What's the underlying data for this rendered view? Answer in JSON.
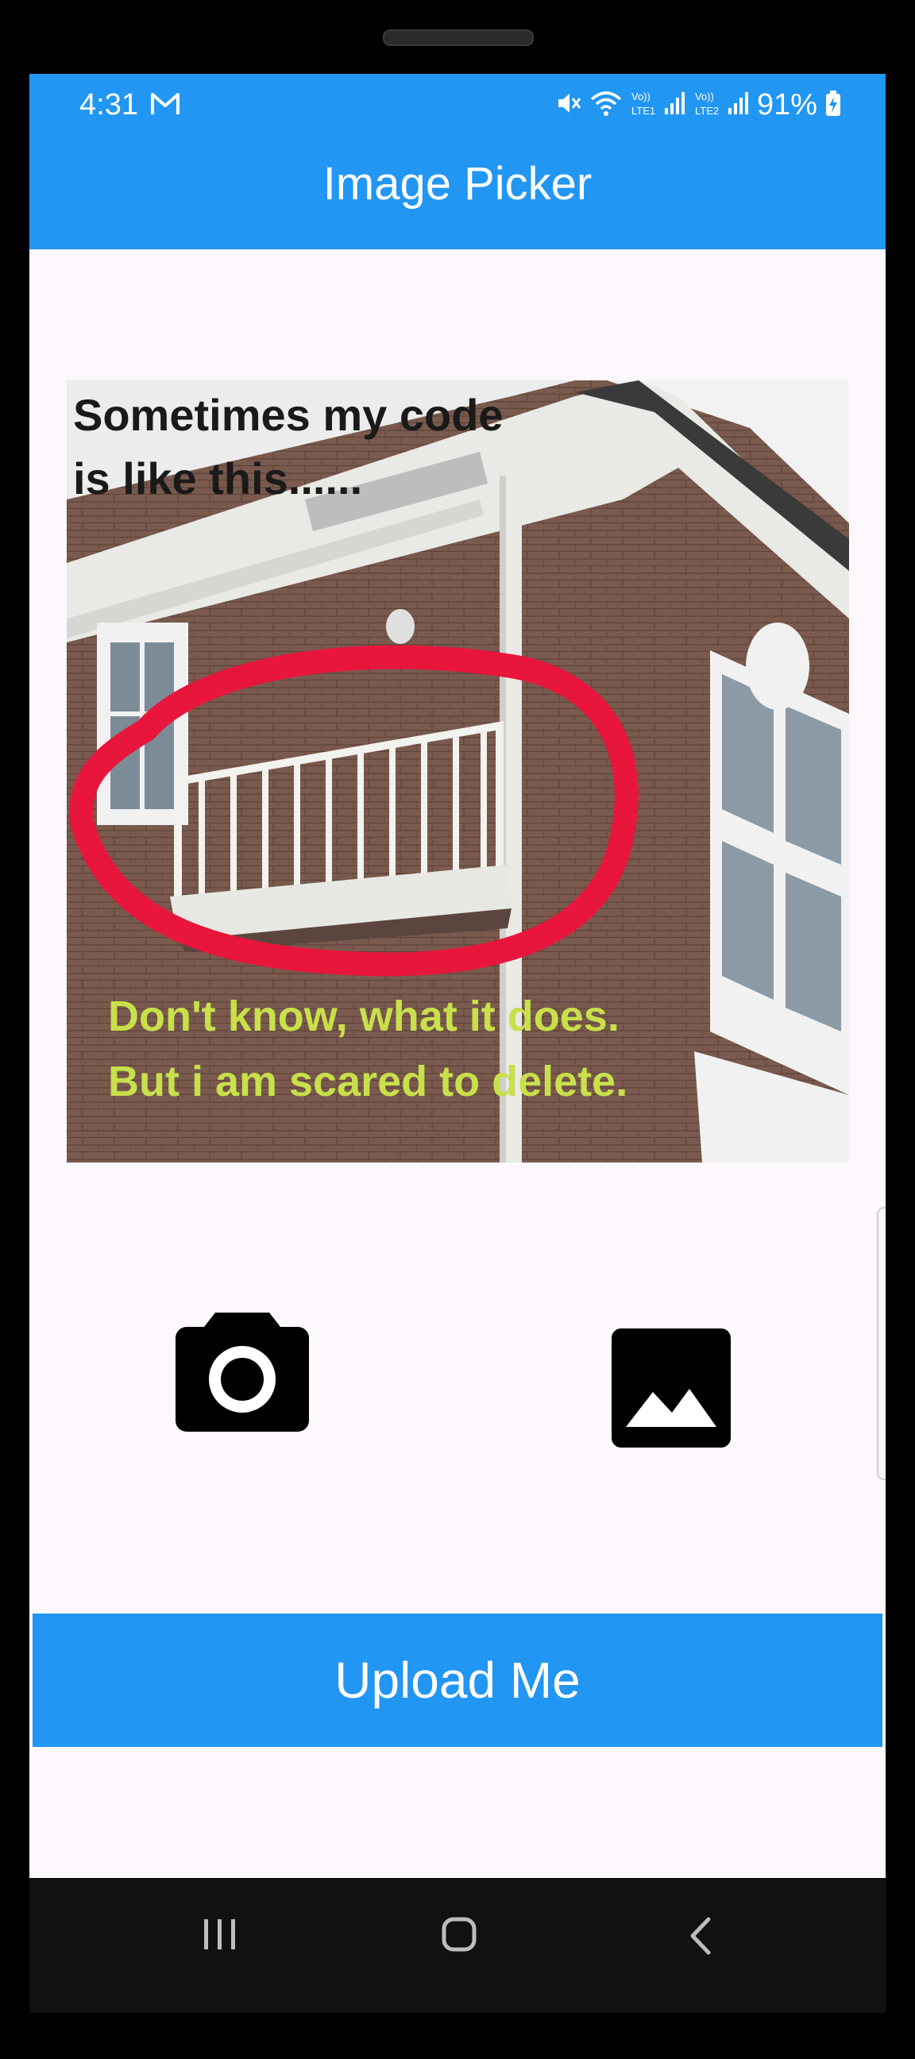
{
  "status_bar": {
    "time": "4:31",
    "sim1": "LTE1",
    "sim2": "LTE2",
    "battery": "91%"
  },
  "app_bar": {
    "title": "Image Picker"
  },
  "selected_image": {
    "caption_top": "Sometimes my code\n is like this......",
    "caption_bottom": "Don't know, what it does.\nBut i am scared to delete."
  },
  "actions": {
    "camera_icon": "camera-icon",
    "gallery_icon": "image-icon"
  },
  "upload_button": {
    "label": "Upload Me"
  },
  "colors": {
    "primary": "#2196f3",
    "background": "#fdf8fd",
    "icon": "#000000"
  }
}
